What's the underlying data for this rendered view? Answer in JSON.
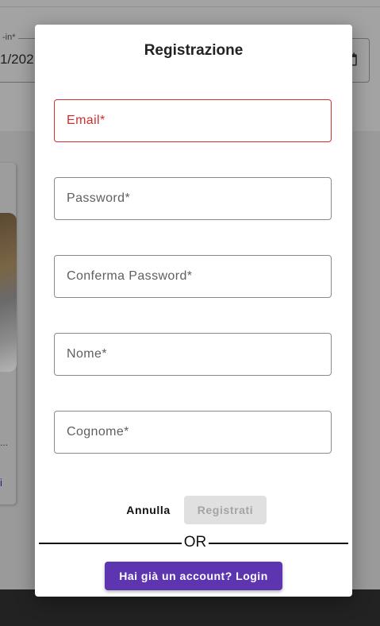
{
  "background": {
    "date_field_label": "-in*",
    "date_field_value": "1/202",
    "card_ellipsis": "...",
    "card_link_text": "i"
  },
  "modal": {
    "title": "Registrazione",
    "fields": [
      {
        "placeholder": "Email*",
        "state": "error"
      },
      {
        "placeholder": "Password*",
        "state": "normal"
      },
      {
        "placeholder": "Conferma Password*",
        "state": "normal"
      },
      {
        "placeholder": "Nome*",
        "state": "normal"
      },
      {
        "placeholder": "Cognome*",
        "state": "normal"
      }
    ],
    "cancel_label": "Annulla",
    "register_label": "Registrati",
    "register_disabled": true,
    "divider_text": "OR",
    "login_label": "Hai già un account? Login"
  },
  "colors": {
    "accent": "#5e35b1",
    "error": "#d32f2f",
    "disabled_bg": "#e0e0e0"
  }
}
